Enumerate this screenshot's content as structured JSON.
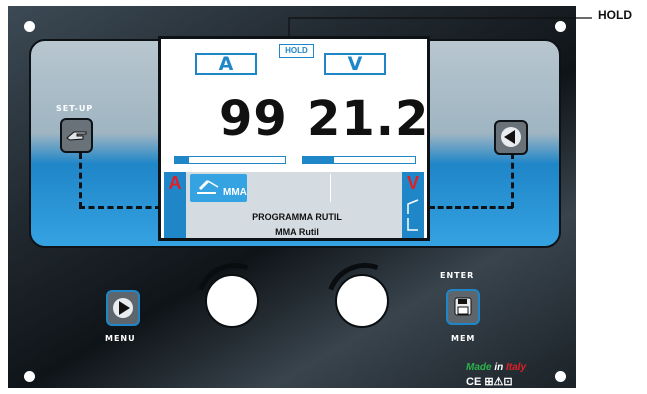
{
  "callout": {
    "hold": "HOLD"
  },
  "screen": {
    "hold_indicator": "HOLD",
    "unit_left": "A",
    "unit_right": "V",
    "current_value": "99",
    "voltage_value": "21.2",
    "current_bar_level": 0.13,
    "voltage_bar_level": 0.28,
    "side_left": "A",
    "side_right": "V",
    "mode_label": "MMA",
    "program_line": "PROGRAMMA RUTIL",
    "program_name": "MMA Rutil"
  },
  "labels": {
    "setup": "SET-UP",
    "menu": "MENU",
    "enter": "ENTER",
    "mem": "MEM"
  },
  "footer": {
    "made": "Made",
    "in": "in",
    "italy": "Italy",
    "cert": "CE ⊞⚠⊡"
  },
  "colors": {
    "accent_blue": "#1f86c8",
    "red": "#e51e25",
    "green": "#2bb34a"
  },
  "icons": {
    "setup_button": "hand-pointer-icon",
    "back_button": "triangle-left-icon",
    "menu_button": "triangle-right-icon",
    "mem_button": "floppy-disk-icon"
  }
}
